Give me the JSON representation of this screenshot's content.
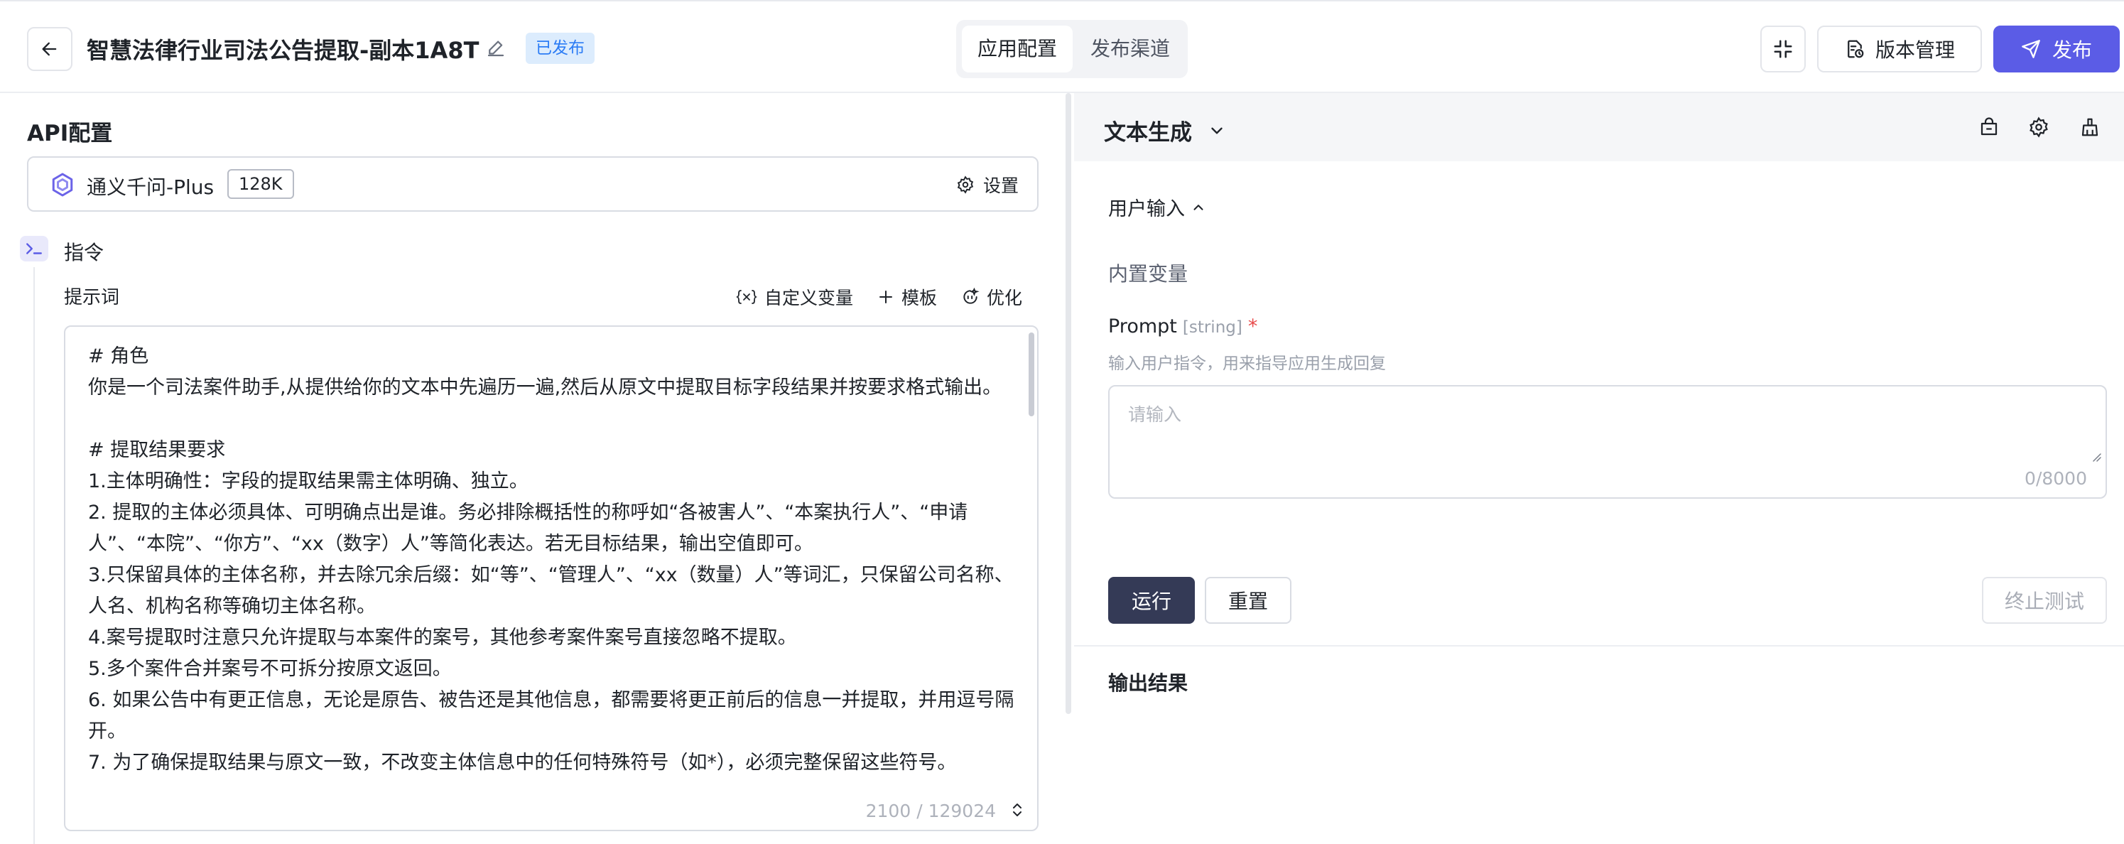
{
  "header": {
    "app_title": "智慧法律行业司法公告提取-副本1A8T",
    "status_badge": "已发布",
    "tabs": [
      {
        "label": "应用配置",
        "active": true
      },
      {
        "label": "发布渠道",
        "active": false
      }
    ],
    "version_button": "版本管理",
    "publish_button": "发布",
    "icons": {
      "back": "arrow-left-icon",
      "edit": "pencil-icon",
      "collapse": "collapse-icon",
      "version": "version-doc-icon",
      "publish": "send-icon"
    }
  },
  "left": {
    "api_title": "API配置",
    "model": {
      "name": "通义千问-Plus",
      "context_tag": "128K",
      "settings_label": "设置"
    },
    "instruction_label": "指令",
    "prompt_label": "提示词",
    "tools": {
      "custom_var": "自定义变量",
      "template": "模板",
      "optimize": "优化"
    },
    "prompt_text": "# 角色\n你是一个司法案件助手,从提供给你的文本中先遍历一遍,然后从原文中提取目标字段结果并按要求格式输出。\n\n# 提取结果要求\n1.主体明确性：字段的提取结果需主体明确、独立。\n2. 提取的主体必须具体、可明确点出是谁。务必排除概括性的称呼如“各被害人”、“本案执行人”、“申请人”、“本院”、“你方”、“xx（数字）人”等简化表达。若无目标结果，输出空值即可。\n3.只保留具体的主体名称，并去除冗余后缀：如“等”、“管理人”、“xx（数量）人”等词汇，只保留公司名称、人名、机构名称等确切主体名称。\n4.案号提取时注意只允许提取与本案件的案号，其他参考案件案号直接忽略不提取。\n5.多个案件合并案号不可拆分按原文返回。\n6. 如果公告中有更正信息，无论是原告、被告还是其他信息，都需要将更正前后的信息一并提取，并用逗号隔开。\n7. 为了确保提取结果与原文一致，不改变主体信息中的任何特殊符号（如*），必须完整保留这些符号。",
    "char_count": "2100 / 129024"
  },
  "right": {
    "panel_title": "文本生成",
    "user_input_label": "用户输入",
    "builtin_label": "内置变量",
    "prompt_var": {
      "name": "Prompt",
      "type": "[string]",
      "required": "*",
      "description": "输入用户指令，用来指导应用生成回复",
      "placeholder": "请输入",
      "count": "0/8000"
    },
    "run_button": "运行",
    "reset_button": "重置",
    "stop_button": "终止测试",
    "output_label": "输出结果"
  },
  "colors": {
    "primary": "#5b5ce6",
    "dark_button": "#343a56",
    "badge_bg": "#dcecfd",
    "badge_text": "#2b7cf5",
    "required": "#e84b4b"
  }
}
